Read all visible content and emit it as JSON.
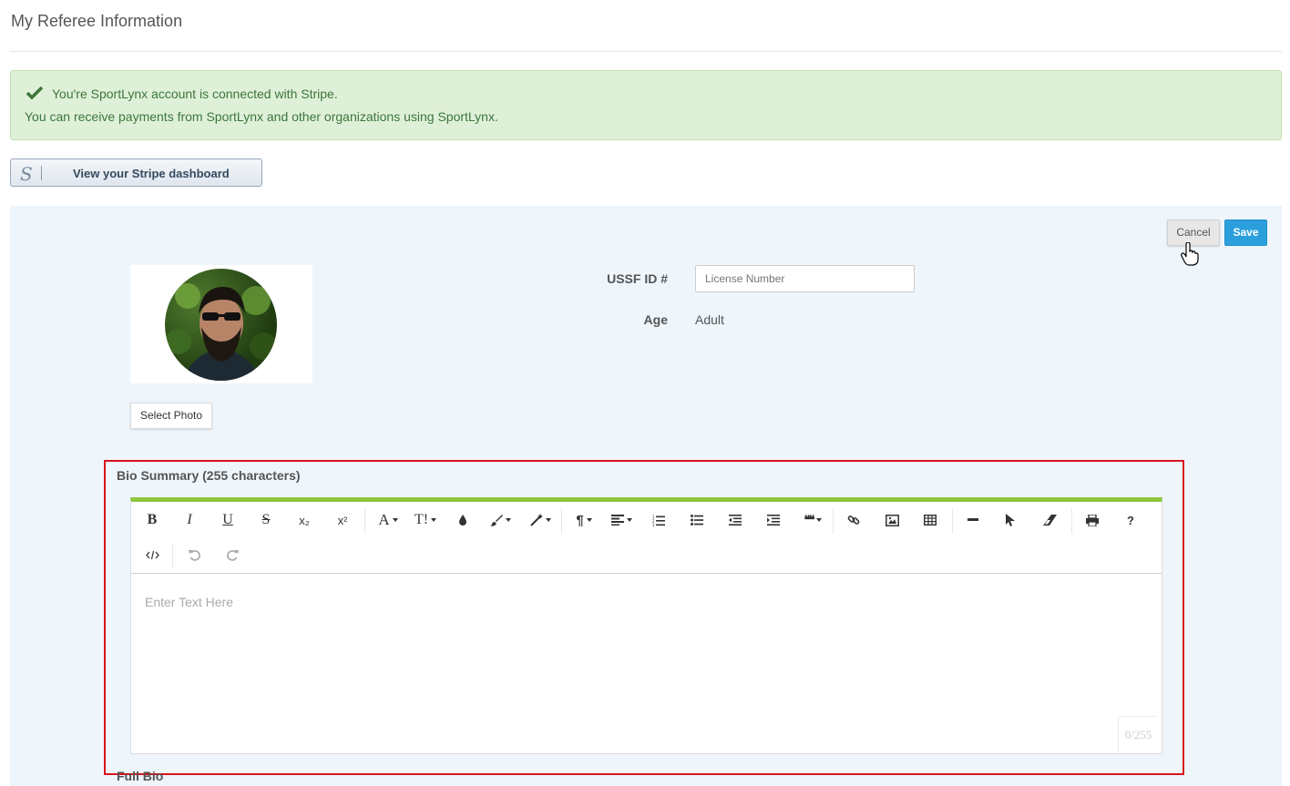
{
  "page": {
    "title": "My Referee Information"
  },
  "alert": {
    "line1": "You're SportLynx account is connected with Stripe.",
    "line2": "You can receive payments from SportLynx and other organizations using SportLynx.",
    "icon": "check-icon"
  },
  "stripe": {
    "button_label": "View your Stripe dashboard",
    "logo_text": "S"
  },
  "actions": {
    "cancel_label": "Cancel",
    "save_label": "Save"
  },
  "photo": {
    "select_label": "Select Photo"
  },
  "fields": {
    "ussf_label": "USSF ID #",
    "ussf_placeholder": "License Number",
    "ussf_value": "",
    "age_label": "Age",
    "age_value": "Adult"
  },
  "bio_summary": {
    "label": "Bio Summary (255 characters)",
    "placeholder": "Enter Text Here",
    "counter": "0/255"
  },
  "full_bio": {
    "label": "Full Bio"
  },
  "toolbar": {
    "bold": "B",
    "italic": "I",
    "underline": "U",
    "strike": "S",
    "subscript": "x₂",
    "superscript": "x²",
    "font_family": "A",
    "font_size": "T!",
    "paragraph": "¶",
    "quote": "❝❝",
    "help": "?"
  },
  "colors": {
    "accent_green": "#8dc63f",
    "save_blue": "#2a9fdb",
    "alert_bg": "#dff0d8",
    "highlight_red": "#d9141b",
    "panel_bg": "#eef5fb"
  }
}
